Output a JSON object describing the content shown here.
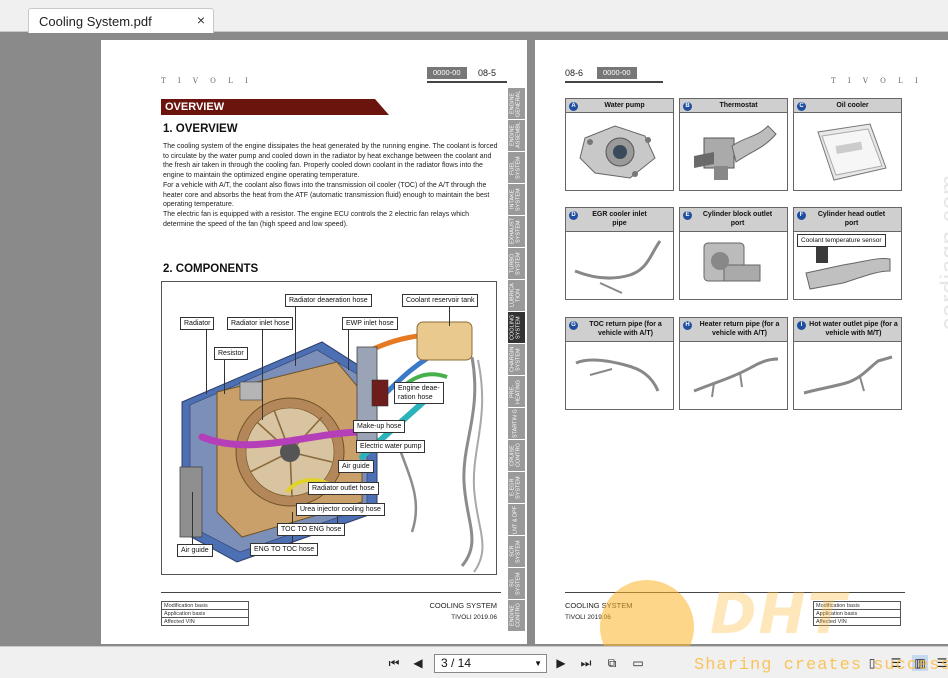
{
  "tab": {
    "title": "Cooling System.pdf",
    "close": "×"
  },
  "left_page": {
    "brand": "T I V O L I",
    "code": "0000-00",
    "page_no": "08-5",
    "overview_banner": "OVERVIEW",
    "overview_title": "1. OVERVIEW",
    "paragraphs": [
      "The cooling system of the engine dissipates the heat generated by the running engine. The coolant is forced to circulate by the water pump and cooled down in the radiator by heat exchange between the coolant and the fresh air taken in through the cooling fan. Properly cooled down coolant in the radiator flows into the engine to maintain the optimized engine operating temperature.",
      "For a vehicle with A/T, the coolant also flows into the transmission oil cooler (TOC) of the A/T through the heater core and absorbs the heat from the ATF (automatic transmission fluid) enough to maintain the best operating temperature.",
      "The electric fan is equipped with a resistor. The engine ECU controls the 2 electric fan relays which determine the speed of the fan (high speed and low speed)."
    ],
    "components_title": "2. COMPONENTS",
    "labels": {
      "radiator_deaeration_hose": "Radiator deaeration hose",
      "coolant_reservoir_tank": "Coolant reservoir tank",
      "radiator": "Radiator",
      "radiator_inlet_hose": "Radiator inlet hose",
      "ewp_inlet_hose": "EWP inlet hose",
      "resistor": "Resistor",
      "engine_deaeration_hose_1": "Engine deae-",
      "engine_deaeration_hose_2": "ration hose",
      "makeup_hose": "Make-up hose",
      "electric_water_pump": "Electric water pump",
      "air_guide_right": "Air guide",
      "radiator_outlet_hose": "Radiator outlet hose",
      "urea_injector_cooling_hose": "Urea injector cooling hose",
      "toc_to_eng_hose": "TOC TO ENG hose",
      "air_guide_left": "Air guide",
      "eng_to_toc_hose": "ENG TO TOC hose"
    },
    "side_tabs": [
      "ENGINE GENERAL",
      "ENGINE ASSEMBL",
      "FUEL SYSTEM",
      "INTAKE SYSTEM",
      "EXHAUST SYSTEM",
      "TURBO SYSTEM",
      "LUBRICA TION",
      "COOLING SYSTEM",
      "CHARGIN SYSTEM",
      "PRE-HEATING",
      "STARTIN G",
      "CRUISE CONTRO",
      "E-EGR SYSTEM",
      "LNT & DPF",
      "SCR SYSTEM",
      "SG SYSTEM",
      "ENGINE CONTRO"
    ],
    "active_tab_index": 7,
    "footer": {
      "rows": [
        "Modification basis",
        "Application basis",
        "Affected VIN"
      ],
      "system": "COOLING SYSTEM",
      "model_date": "TIVOLI 2019.06"
    }
  },
  "right_page": {
    "page_no": "08-6",
    "code": "0000-00",
    "brand": "T I V O L I",
    "cards": [
      {
        "letter": "A",
        "title": "Water pump"
      },
      {
        "letter": "B",
        "title": "Thermostat"
      },
      {
        "letter": "C",
        "title": "Oil cooler"
      },
      {
        "letter": "D",
        "title": "EGR cooler inlet pipe"
      },
      {
        "letter": "E",
        "title": "Cylinder block outlet port"
      },
      {
        "letter": "F",
        "title": "Cylinder head outlet port",
        "callout": "Coolant temperature sensor"
      },
      {
        "letter": "G",
        "title": "TOC return pipe (for a vehicle with A/T)"
      },
      {
        "letter": "H",
        "title": "Heater return pipe (for a vehicle with A/T)"
      },
      {
        "letter": "I",
        "title": "Hot water outlet pipe (for a vehicle with M/T)"
      }
    ],
    "footer": {
      "system": "COOLING SYSTEM",
      "model_date": "TIVOLI 2019.06",
      "rows": [
        "Modification basis",
        "Application basis",
        "Affected VIN"
      ]
    }
  },
  "watermark": {
    "side": "cardiagn.com",
    "logo": "DHT",
    "share": "Sharing creates success"
  },
  "toolbar": {
    "page_indicator": "3 / 14"
  }
}
